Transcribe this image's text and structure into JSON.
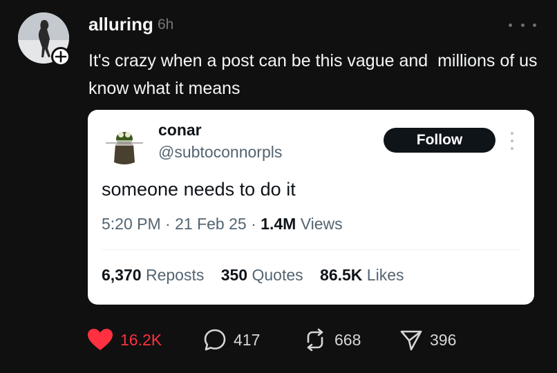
{
  "post": {
    "author": "alluring",
    "time": "6h",
    "text": "It's crazy when a post can be this vague and  millions of us know what it means"
  },
  "quoted_tweet": {
    "name": "conar",
    "handle": "@subtoconnorpls",
    "follow_label": "Follow",
    "text": "someone needs to do it",
    "meta": {
      "time": "5:20 PM",
      "date": "21 Feb 25",
      "views_count": "1.4M",
      "views_label": "Views"
    },
    "stats": {
      "reposts_count": "6,370",
      "reposts_label": "Reposts",
      "quotes_count": "350",
      "quotes_label": "Quotes",
      "likes_count": "86.5K",
      "likes_label": "Likes"
    }
  },
  "actions": {
    "likes": "16.2K",
    "replies": "417",
    "reposts": "668",
    "shares": "396"
  },
  "icons": {
    "like": "heart-icon",
    "reply": "comment-bubble-icon",
    "repost": "repost-icon",
    "share": "send-icon",
    "more": "ellipsis-icon"
  },
  "colors": {
    "background": "#101010",
    "like_active": "#ff3040",
    "card_bg": "#ffffff",
    "follow_btn": "#0f1419"
  }
}
